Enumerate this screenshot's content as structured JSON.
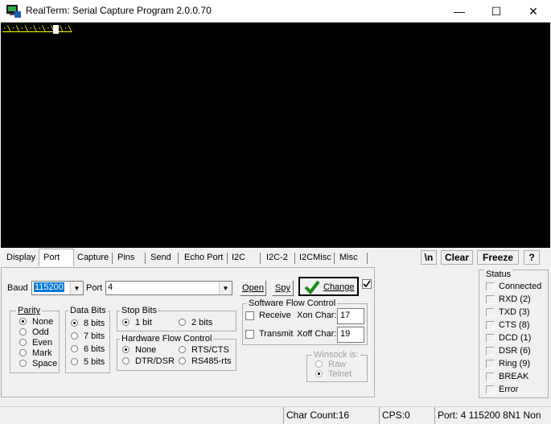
{
  "window": {
    "title": "RealTerm: Serial Capture Program 2.0.0.70",
    "minimize": "—",
    "maximize": "☐",
    "close": "✕"
  },
  "terminal": {
    "text": "·\\·\\·\\·\\·\\·\\·\\·\\"
  },
  "tabs": [
    {
      "label": "Display"
    },
    {
      "label": "Port"
    },
    {
      "label": "Capture"
    },
    {
      "label": "Pins"
    },
    {
      "label": "Send"
    },
    {
      "label": "Echo Port"
    },
    {
      "label": "I2C"
    },
    {
      "label": "I2C-2"
    },
    {
      "label": "I2CMisc"
    },
    {
      "label": "Misc"
    }
  ],
  "toolbar": {
    "newline": "\\n",
    "clear": "Clear",
    "freeze": "Freeze",
    "help": "?"
  },
  "port": {
    "baud_label": "Baud",
    "baud_value": "115200",
    "port_label": "Port",
    "port_value": "4",
    "open_label": "Open",
    "spy_label": "Spy",
    "change_label": "Change",
    "change_checked": true
  },
  "parity": {
    "title": "Parity",
    "options": [
      "None",
      "Odd",
      "Even",
      "Mark",
      "Space"
    ],
    "selected": "None"
  },
  "databits": {
    "title": "Data Bits",
    "options": [
      "8 bits",
      "7 bits",
      "6 bits",
      "5 bits"
    ],
    "selected": "8 bits"
  },
  "stopbits": {
    "title": "Stop Bits",
    "options": [
      "1 bit",
      "2 bits"
    ],
    "selected": "1 bit"
  },
  "hwflow": {
    "title": "Hardware Flow Control",
    "options": [
      "None",
      "RTS/CTS",
      "DTR/DSR",
      "RS485-rts"
    ],
    "selected": "None"
  },
  "swflow": {
    "title": "Software Flow Control",
    "receive": "Receive",
    "transmit": "Transmit",
    "xon_label": "Xon Char:",
    "xon_value": "17",
    "xoff_label": "Xoff Char:",
    "xoff_value": "19"
  },
  "winsock": {
    "title": "Winsock is:",
    "options": [
      "Raw",
      "Telnet"
    ],
    "selected": "Telnet"
  },
  "status": {
    "title": "Status",
    "items": [
      "Connected",
      "RXD (2)",
      "TXD (3)",
      "CTS (8)",
      "DCD (1)",
      "DSR (6)",
      "Ring (9)",
      "BREAK",
      "Error"
    ]
  },
  "statusbar": {
    "charcount": "Char Count:16",
    "cps": "CPS:0",
    "portinfo": "Port: 4 115200 8N1 Non"
  }
}
